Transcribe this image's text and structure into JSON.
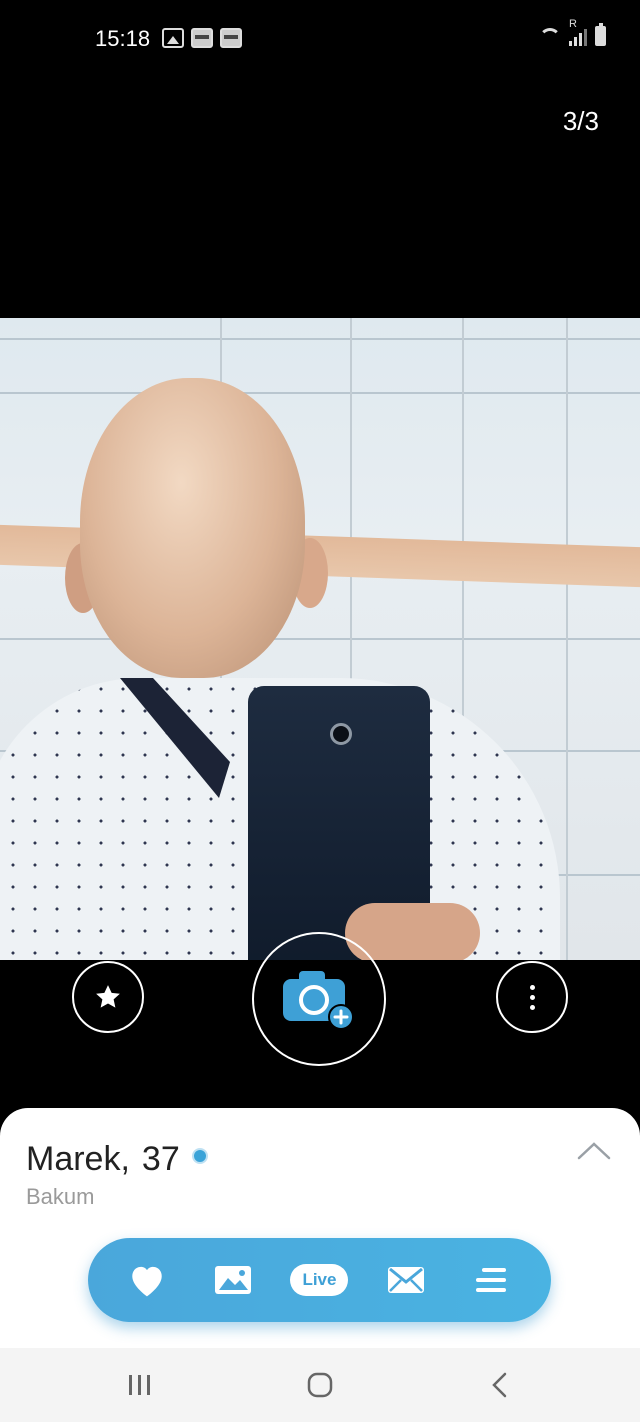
{
  "status_bar": {
    "time": "15:18",
    "left_icons": [
      "gallery-icon",
      "slots-app-icon",
      "slots-app-icon"
    ],
    "right_icons": [
      "wifi-icon",
      "signal-icon",
      "battery-icon"
    ],
    "network_label": "R"
  },
  "gallery": {
    "counter": "3/3"
  },
  "photo_controls": {
    "favorite_icon": "star-icon",
    "add_photo_icon": "camera-plus-icon",
    "more_icon": "more-vertical-icon"
  },
  "profile": {
    "name": "Marek,",
    "age": "37",
    "location": "Bakum",
    "online": true,
    "accent_color": "#3aa3d8"
  },
  "action_bar": {
    "items": [
      {
        "icon": "heart-icon"
      },
      {
        "icon": "photos-icon"
      },
      {
        "icon": "live-icon",
        "label": "Live"
      },
      {
        "icon": "mail-icon"
      },
      {
        "icon": "menu-icon"
      }
    ],
    "color": "#4aa7db"
  },
  "nav_bar": {
    "items": [
      "recent-apps-icon",
      "home-icon",
      "back-icon"
    ]
  }
}
